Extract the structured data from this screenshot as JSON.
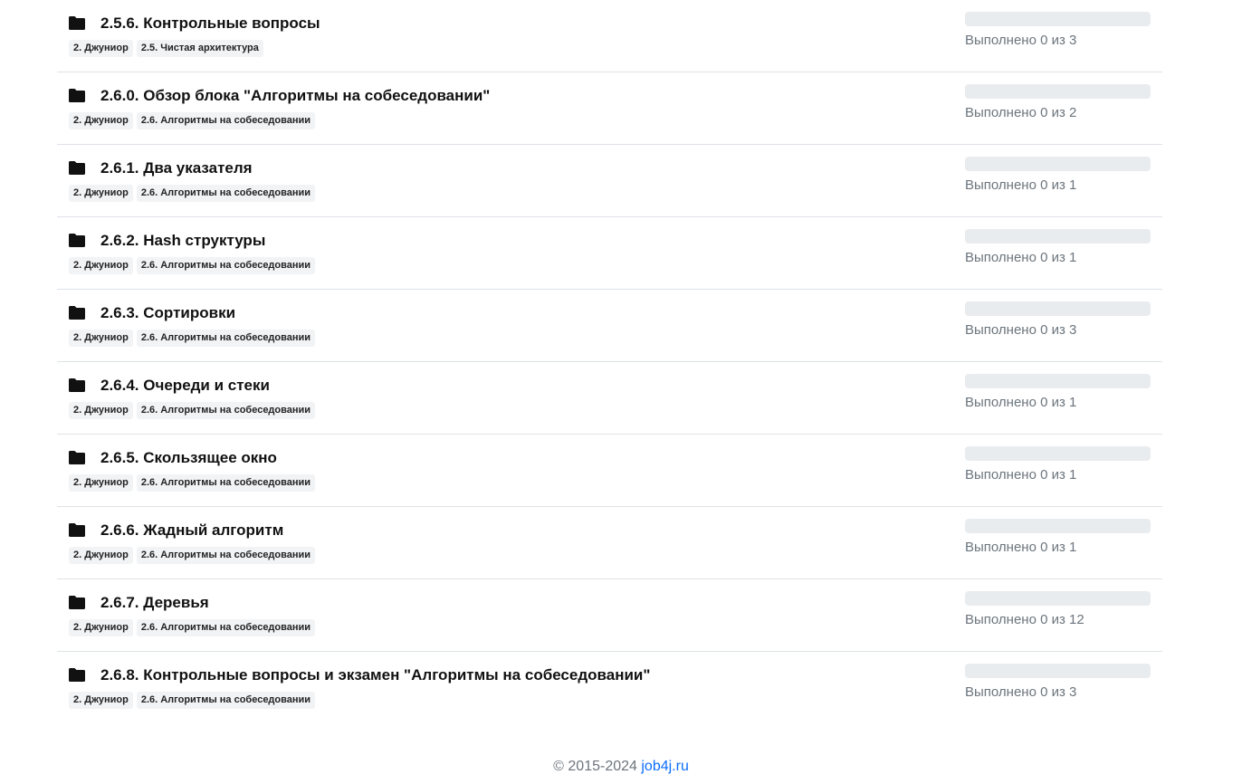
{
  "items": [
    {
      "title": "2.5.6. Контрольные вопросы",
      "tags": [
        "2. Джуниор",
        "2.5. Чистая архитектура"
      ],
      "status": "Выполнено 0 из 3",
      "progress": 0
    },
    {
      "title": "2.6.0. Обзор блока \"Алгоритмы на собеседовании\"",
      "tags": [
        "2. Джуниор",
        "2.6. Алгоритмы на собеседовании"
      ],
      "status": "Выполнено 0 из 2",
      "progress": 0
    },
    {
      "title": "2.6.1. Два указателя",
      "tags": [
        "2. Джуниор",
        "2.6. Алгоритмы на собеседовании"
      ],
      "status": "Выполнено 0 из 1",
      "progress": 0
    },
    {
      "title": "2.6.2. Hash структуры",
      "tags": [
        "2. Джуниор",
        "2.6. Алгоритмы на собеседовании"
      ],
      "status": "Выполнено 0 из 1",
      "progress": 0
    },
    {
      "title": "2.6.3. Сортировки",
      "tags": [
        "2. Джуниор",
        "2.6. Алгоритмы на собеседовании"
      ],
      "status": "Выполнено 0 из 3",
      "progress": 0
    },
    {
      "title": "2.6.4. Очереди и стеки",
      "tags": [
        "2. Джуниор",
        "2.6. Алгоритмы на собеседовании"
      ],
      "status": "Выполнено 0 из 1",
      "progress": 0
    },
    {
      "title": "2.6.5. Скользящее окно",
      "tags": [
        "2. Джуниор",
        "2.6. Алгоритмы на собеседовании"
      ],
      "status": "Выполнено 0 из 1",
      "progress": 0
    },
    {
      "title": "2.6.6. Жадный алгоритм",
      "tags": [
        "2. Джуниор",
        "2.6. Алгоритмы на собеседовании"
      ],
      "status": "Выполнено 0 из 1",
      "progress": 0
    },
    {
      "title": "2.6.7. Деревья",
      "tags": [
        "2. Джуниор",
        "2.6. Алгоритмы на собеседовании"
      ],
      "status": "Выполнено 0 из 12",
      "progress": 0
    },
    {
      "title": "2.6.8. Контрольные вопросы и экзамен \"Алгоритмы на собеседовании\"",
      "tags": [
        "2. Джуниор",
        "2.6. Алгоритмы на собеседовании"
      ],
      "status": "Выполнено 0 из 3",
      "progress": 0
    }
  ],
  "icon": "folder-icon",
  "footer": {
    "copyright": "© 2015-2024",
    "link_text": "job4j.ru"
  },
  "colors": {
    "link": "#0d6efd",
    "progress_track": "#e9ecef",
    "muted_text": "#6c757d"
  }
}
